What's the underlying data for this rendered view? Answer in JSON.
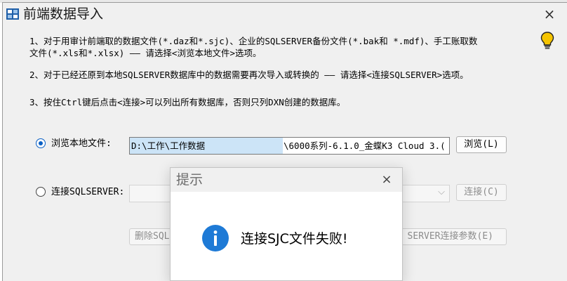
{
  "window": {
    "title": "前端数据导入",
    "close_glyph": "×",
    "icon": "app-icon"
  },
  "instructions": {
    "line1a": "1、对于用审计前端取的数据文件(*.daz和*.sjc)、企业的SQLSERVER备份文件(*.bak和 *.mdf)、手工账取数",
    "line1b": "文件(*.xls和*.xlsx) —— 请选择<浏览本地文件>选项。",
    "line2": "2、对于已经还原到本地SQLSERVER数据库中的数据需要再次导入或转换的   —— 请选择<连接SQLSERVER>选项。",
    "line3": "3、按住Ctrl键后点击<连接>可以列出所有数据库，否则只列DXN创建的数据库。",
    "hint_icon": "lightbulb-icon"
  },
  "local_file": {
    "label": "浏览本地文件:",
    "selected": true,
    "path_part1": "D:\\工作\\工作数据",
    "path_part2": "\\6000系列-6.1.0_金蝶K3 Cloud 3.(",
    "browse_label": "浏览(L)"
  },
  "sqlserver": {
    "label": "连接SQLSERVER:",
    "selected": false,
    "connect_label": "连接(C)",
    "delete_label": "删除SQL",
    "params_label": "SERVER连接参数(E)"
  },
  "dialog": {
    "title": "提示",
    "close_glyph": "×",
    "message": "连接SJC文件失败!",
    "icon": "info-icon"
  },
  "colors": {
    "accent": "#0a5fc4",
    "info_blue": "#1e7ad6",
    "bulb_yellow": "#f5c400",
    "selection": "#cce4f7"
  }
}
